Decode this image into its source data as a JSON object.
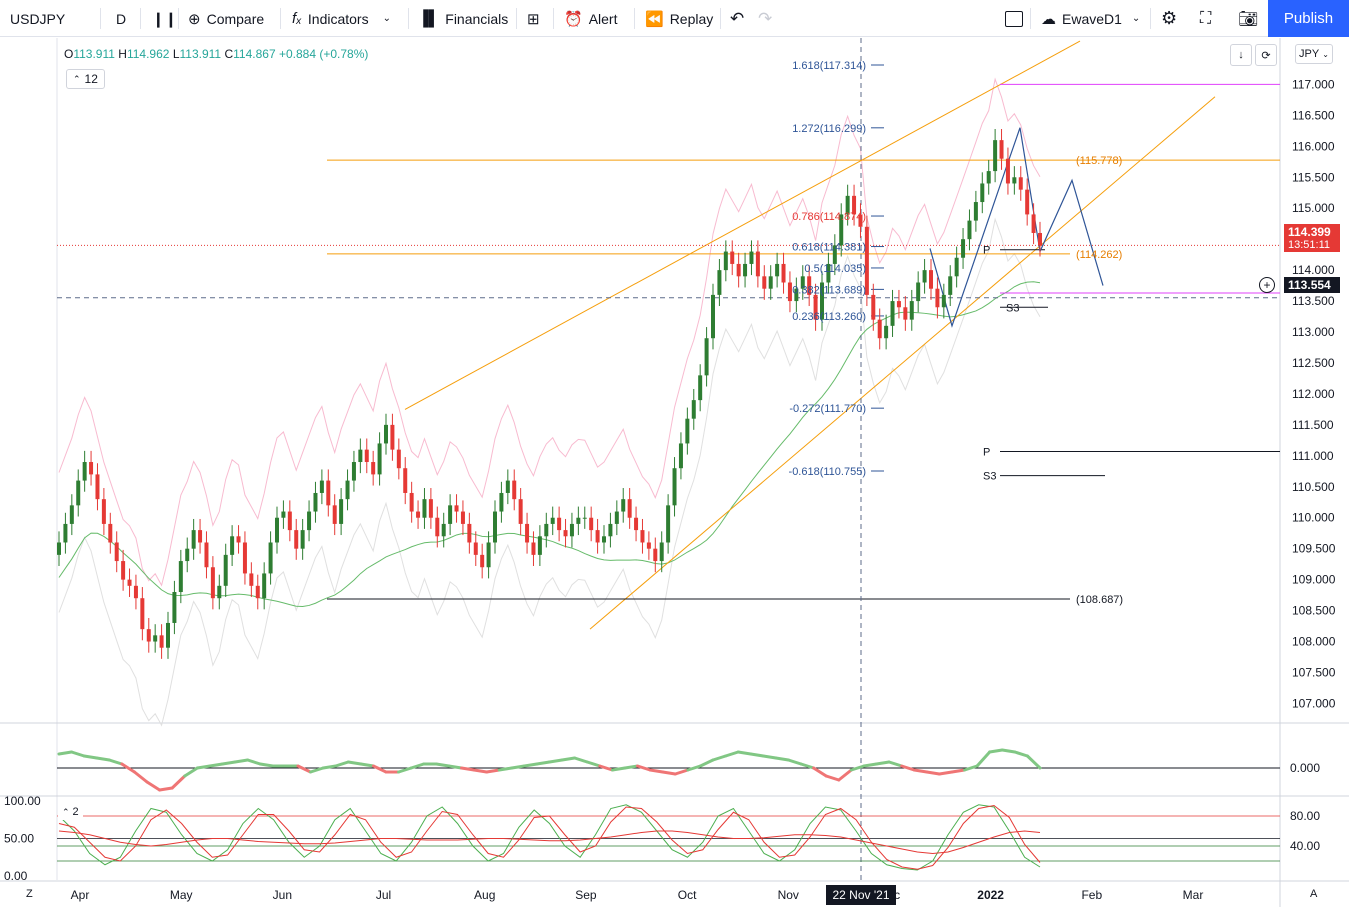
{
  "toolbar": {
    "symbol": "USDJPY",
    "interval": "D",
    "compare": "Compare",
    "indicators": "Indicators",
    "financials": "Financials",
    "alert": "Alert",
    "replay": "Replay",
    "layout_name": "EwaveD1",
    "publish": "Publish"
  },
  "legend": {
    "o_label": "O",
    "o": "113.911",
    "h_label": "H",
    "h": "114.962",
    "l_label": "L",
    "l": "113.911",
    "c_label": "C",
    "c": "114.867",
    "change": "+0.884 (+0.78%)",
    "indicator_count": "12",
    "osc_count": "2"
  },
  "currency": "JPY",
  "crosshair_date": "22 Nov '21",
  "price_tags": {
    "last": "114.399",
    "countdown": "13:51:11",
    "cursor": "113.554"
  },
  "colors": {
    "up": "#2e7d32",
    "down": "#e53935",
    "accent": "#2962ff",
    "fib": "#2f5597",
    "orange": "#f59e0b",
    "magenta": "#e040fb"
  },
  "chart_data": [
    {
      "type": "candlestick",
      "x_ticks": [
        "Apr",
        "May",
        "Jun",
        "Jul",
        "Aug",
        "Sep",
        "Oct",
        "Nov",
        "Dec",
        "2022",
        "Feb",
        "Mar"
      ],
      "y_ticks": [
        107.0,
        107.5,
        108.0,
        108.5,
        109.0,
        109.5,
        110.0,
        110.5,
        111.0,
        111.5,
        112.0,
        112.5,
        113.0,
        113.5,
        114.0,
        114.5,
        115.0,
        115.5,
        116.0,
        116.5,
        117.0
      ],
      "ylim": [
        106.7,
        117.75
      ],
      "close": [
        109.6,
        109.9,
        110.2,
        110.6,
        110.9,
        110.7,
        110.3,
        109.9,
        109.6,
        109.3,
        109.0,
        108.9,
        108.7,
        108.2,
        108.0,
        108.1,
        107.9,
        108.3,
        108.8,
        109.3,
        109.5,
        109.8,
        109.6,
        109.2,
        108.7,
        108.9,
        109.4,
        109.7,
        109.6,
        109.1,
        108.9,
        108.7,
        109.1,
        109.6,
        110.0,
        110.1,
        109.8,
        109.5,
        109.8,
        110.1,
        110.4,
        110.6,
        110.2,
        109.9,
        110.3,
        110.6,
        110.9,
        111.1,
        110.9,
        110.7,
        111.2,
        111.5,
        111.1,
        110.8,
        110.4,
        110.1,
        110.0,
        110.3,
        110.0,
        109.7,
        109.9,
        110.2,
        110.1,
        109.9,
        109.6,
        109.4,
        109.2,
        109.6,
        110.1,
        110.4,
        110.6,
        110.3,
        109.9,
        109.6,
        109.4,
        109.7,
        109.9,
        110.0,
        109.8,
        109.7,
        109.9,
        110.0,
        110.0,
        109.8,
        109.6,
        109.7,
        109.9,
        110.1,
        110.3,
        110.0,
        109.8,
        109.6,
        109.5,
        109.3,
        109.6,
        110.2,
        110.8,
        111.2,
        111.6,
        111.9,
        112.3,
        112.9,
        113.6,
        114.0,
        114.3,
        114.1,
        113.9,
        114.1,
        114.3,
        113.9,
        113.7,
        113.9,
        114.1,
        113.8,
        113.5,
        113.7,
        113.9,
        113.6,
        113.2,
        113.8,
        114.1,
        114.4,
        114.9,
        115.2,
        114.9,
        114.7,
        113.6,
        113.2,
        112.9,
        113.1,
        113.5,
        113.4,
        113.2,
        113.5,
        113.8,
        114.0,
        113.7,
        113.4,
        113.6,
        113.9,
        114.2,
        114.5,
        114.8,
        115.1,
        115.4,
        115.6,
        116.1,
        115.8,
        115.4,
        115.5,
        115.3,
        114.9,
        114.6,
        114.4
      ],
      "indicator_labels": [
        {
          "text": "1.618(117.314)",
          "value": 117.314
        },
        {
          "text": "1.272(116.299)",
          "value": 116.299
        },
        {
          "text": "0.786(114.874)",
          "value": 114.874
        },
        {
          "text": "0.618(114.381)",
          "value": 114.381
        },
        {
          "text": "0.5(114.035)",
          "value": 114.035
        },
        {
          "text": "0.382(113.689)",
          "value": 113.689
        },
        {
          "text": "0.236(113.260)",
          "value": 113.26
        },
        {
          "text": "-0.272(111.770)",
          "value": 111.77
        },
        {
          "text": "-0.618(110.755)",
          "value": 110.755
        },
        {
          "text": "(115.778)",
          "value": 115.778
        },
        {
          "text": "(114.262)",
          "value": 114.262
        },
        {
          "text": "(108.687)",
          "value": 108.687
        }
      ],
      "pivot_labels": [
        "P",
        "S3",
        "P",
        "S3"
      ]
    },
    {
      "type": "line",
      "name": "",
      "y_ticks": [
        0.0
      ],
      "values": [
        0.35,
        0.4,
        0.3,
        0.25,
        0.2,
        0.1,
        -0.1,
        -0.35,
        -0.55,
        -0.5,
        -0.2,
        0.0,
        0.05,
        0.1,
        0.15,
        0.2,
        0.1,
        0.05,
        0.05,
        0.05,
        -0.1,
        0.0,
        0.05,
        0.15,
        0.1,
        0.05,
        -0.1,
        -0.1,
        0.0,
        0.1,
        0.1,
        0.05,
        0.0,
        -0.05,
        -0.1,
        -0.05,
        0.0,
        0.05,
        0.1,
        0.15,
        0.2,
        0.25,
        0.15,
        0.05,
        -0.05,
        0.0,
        0.05,
        -0.05,
        -0.1,
        -0.15,
        -0.05,
        0.05,
        0.2,
        0.3,
        0.4,
        0.35,
        0.3,
        0.25,
        0.2,
        0.1,
        0.0,
        -0.2,
        -0.3,
        -0.05,
        0.05,
        0.1,
        0.15,
        0.05,
        -0.05,
        -0.1,
        -0.15,
        -0.1,
        -0.05,
        0.05,
        0.4,
        0.45,
        0.4,
        0.3,
        0.0
      ]
    },
    {
      "type": "line",
      "name": "",
      "y_ticks": [
        40.0,
        80.0
      ],
      "left_ticks": [
        100.0,
        50.0,
        0.0
      ],
      "ylim": [
        0,
        100
      ],
      "series": [
        {
          "values": [
            80,
            60,
            30,
            15,
            25,
            60,
            90,
            85,
            55,
            30,
            20,
            35,
            70,
            90,
            75,
            45,
            25,
            40,
            75,
            90,
            60,
            30,
            20,
            45,
            80,
            92,
            70,
            40,
            20,
            30,
            65,
            88,
            70,
            40,
            25,
            55,
            90,
            95,
            85,
            60,
            35,
            25,
            45,
            80,
            90,
            60,
            30,
            20,
            35,
            70,
            92,
            88,
            60,
            30,
            15,
            10,
            8,
            20,
            55,
            85,
            95,
            92,
            60,
            25,
            12
          ]
        },
        {
          "values": [
            70,
            65,
            45,
            25,
            20,
            40,
            75,
            88,
            70,
            45,
            25,
            28,
            55,
            82,
            82,
            60,
            35,
            32,
            55,
            82,
            75,
            45,
            25,
            32,
            60,
            86,
            82,
            55,
            30,
            25,
            48,
            78,
            80,
            55,
            32,
            40,
            72,
            92,
            90,
            72,
            48,
            30,
            35,
            62,
            85,
            75,
            45,
            25,
            28,
            52,
            82,
            90,
            75,
            45,
            22,
            12,
            9,
            14,
            38,
            70,
            90,
            94,
            78,
            42,
            18
          ]
        },
        {
          "values": [
            60,
            58,
            55,
            50,
            45,
            42,
            40,
            42,
            45,
            48,
            50,
            50,
            48,
            46,
            45,
            44,
            43,
            43,
            44,
            46,
            48,
            50,
            50,
            49,
            48,
            48,
            48,
            49,
            50,
            50,
            49,
            48,
            47,
            47,
            48,
            50,
            52,
            55,
            58,
            60,
            60,
            58,
            55,
            52,
            50,
            50,
            51,
            53,
            55,
            55,
            54,
            52,
            48,
            44,
            40,
            36,
            32,
            30,
            32,
            38,
            45,
            52,
            58,
            60,
            58
          ]
        }
      ]
    }
  ]
}
